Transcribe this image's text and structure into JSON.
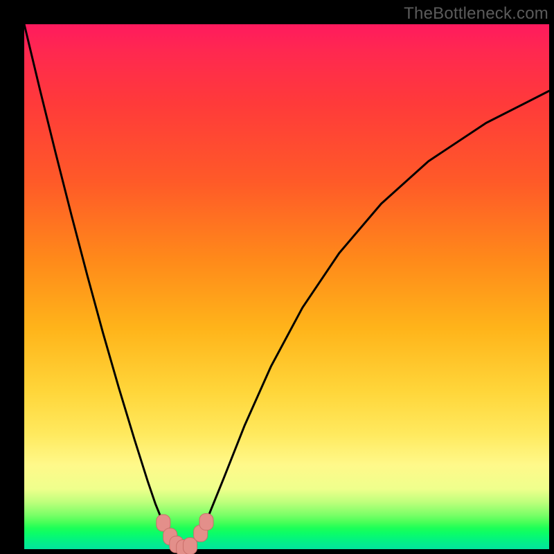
{
  "watermark": "TheBottleneck.com",
  "colors": {
    "curve": "#000000",
    "marker_fill": "#e38f8a",
    "marker_stroke": "#c96f6a",
    "frame": "#000000"
  },
  "chart_data": {
    "type": "line",
    "title": "",
    "xlabel": "",
    "ylabel": "",
    "xlim": [
      0,
      100
    ],
    "ylim": [
      0,
      100
    ],
    "grid": false,
    "legend": false,
    "series": [
      {
        "name": "bottleneck-curve",
        "x": [
          0,
          3,
          6,
          9,
          12,
          15,
          18,
          21,
          23.5,
          25,
          26.5,
          28,
          29.5,
          30.5,
          31.5,
          33,
          35,
          38,
          42,
          47,
          53,
          60,
          68,
          77,
          88,
          100
        ],
        "values": [
          100,
          87.5,
          75.4,
          63.6,
          52.2,
          41.2,
          30.8,
          20.9,
          13.0,
          8.6,
          4.9,
          2.2,
          0.7,
          0.15,
          0.6,
          2.3,
          6.1,
          13.5,
          23.6,
          34.8,
          46.0,
          56.4,
          65.8,
          73.9,
          81.2,
          87.3
        ]
      }
    ],
    "markers": [
      {
        "x": 26.5,
        "y": 5.0
      },
      {
        "x": 27.8,
        "y": 2.4
      },
      {
        "x": 29.0,
        "y": 0.9
      },
      {
        "x": 30.3,
        "y": 0.2
      },
      {
        "x": 31.6,
        "y": 0.6
      },
      {
        "x": 33.6,
        "y": 3.0
      },
      {
        "x": 34.7,
        "y": 5.2
      }
    ]
  }
}
